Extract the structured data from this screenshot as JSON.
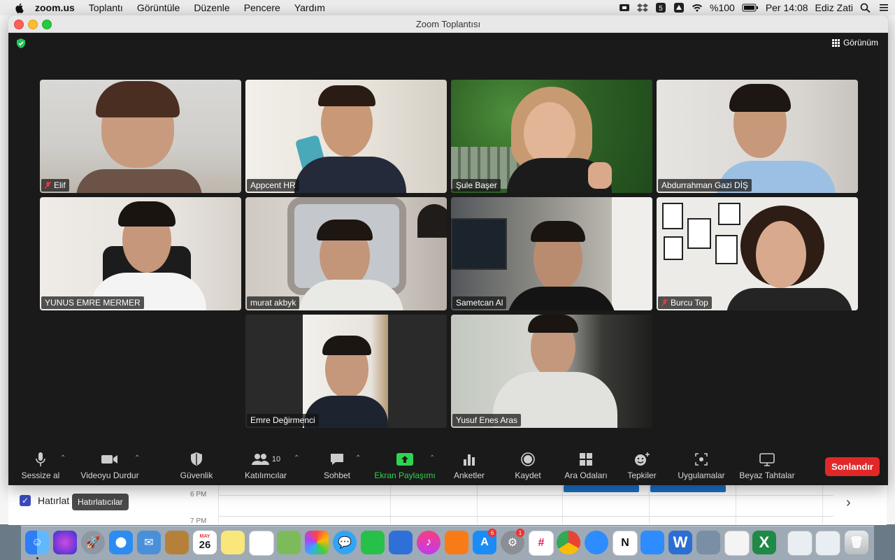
{
  "menubar": {
    "app_name": "zoom.us",
    "items": [
      "Toplantı",
      "Görüntüle",
      "Düzenle",
      "Pencere",
      "Yardım"
    ],
    "battery": "%100",
    "clock": "Per 14:08",
    "user": "Ediz Zati"
  },
  "window": {
    "title": "Zoom Toplantısı",
    "view_label": "Görünüm"
  },
  "participants": [
    {
      "name": "Elif",
      "muted": true,
      "active": false
    },
    {
      "name": "Appcent HR",
      "muted": false,
      "active": false
    },
    {
      "name": "Şule Başer",
      "muted": false,
      "active": true
    },
    {
      "name": "Abdurrahman Gazi DİŞ",
      "muted": false,
      "active": false
    },
    {
      "name": "YUNUS EMRE MERMER",
      "muted": false,
      "active": false
    },
    {
      "name": "murat akbyk",
      "muted": false,
      "active": false
    },
    {
      "name": "Sametcan Al",
      "muted": false,
      "active": false
    },
    {
      "name": "Burcu Top",
      "muted": true,
      "active": false
    },
    {
      "name": "Emre Değirmenci",
      "muted": false,
      "active": false
    },
    {
      "name": "Yusuf Enes Aras",
      "muted": false,
      "active": false
    }
  ],
  "toolbar": {
    "mute": "Sessize al",
    "video": "Videoyu Durdur",
    "security": "Güvenlik",
    "participants": "Katılımcılar",
    "participants_count": "10",
    "chat": "Sohbet",
    "share": "Ekran Paylaşımı",
    "polls": "Anketler",
    "record": "Kaydet",
    "breakout": "Ara Odaları",
    "reactions": "Tepkiler",
    "apps": "Uygulamalar",
    "whiteboard": "Beyaz Tahtalar",
    "end": "Sonlandır"
  },
  "background_app": {
    "reminders_label": "Hatırlat",
    "tooltip": "Hatırlatıcılar",
    "time_6pm": "6 PM",
    "time_7pm": "7 PM"
  },
  "dock": {
    "calendar_month": "MAY",
    "calendar_day": "26",
    "badge_app_store": "6",
    "badge_settings": "1"
  },
  "colors": {
    "active_speaker": "#2fd04f",
    "share_green": "#2ed34f",
    "end_red": "#e02828"
  }
}
